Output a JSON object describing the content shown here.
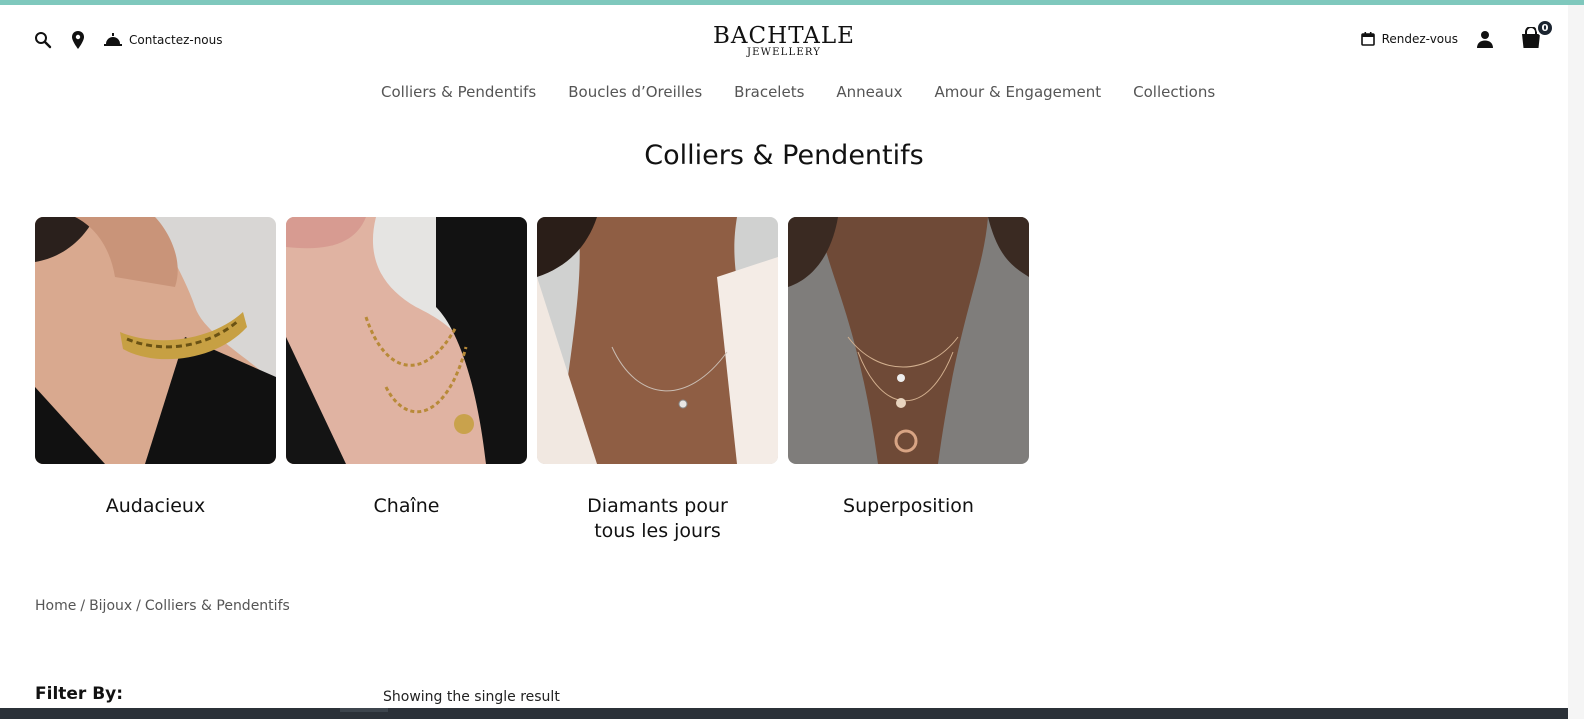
{
  "colors": {
    "accent": "#7fc8bd",
    "text": "#111111",
    "muted": "#555555",
    "badge": "#1b2430"
  },
  "header": {
    "icons": [
      "search-icon",
      "location-pin-icon",
      "service-bell-icon"
    ],
    "contact_label": "Contactez-nous",
    "logo_main": "BACHTALE",
    "logo_sub": "JEWELLERY",
    "appointment_label": "Rendez-vous",
    "cart_count": "0"
  },
  "nav": {
    "items": [
      {
        "label": "Colliers & Pendentifs"
      },
      {
        "label": "Boucles d’Oreilles"
      },
      {
        "label": "Bracelets"
      },
      {
        "label": "Anneaux"
      },
      {
        "label": "Amour & Engagement"
      },
      {
        "label": "Collections"
      }
    ]
  },
  "page": {
    "title": "Colliers & Pendentifs"
  },
  "categories": [
    {
      "label": "Audacieux"
    },
    {
      "label": "Chaîne"
    },
    {
      "label": "Diamants pour tous les jours"
    },
    {
      "label": "Superposition"
    }
  ],
  "breadcrumb": {
    "items": [
      {
        "label": "Home"
      },
      {
        "label": "Bijoux"
      },
      {
        "label": "Colliers & Pendentifs"
      }
    ],
    "separator": "/"
  },
  "shop": {
    "filter_label": "Filter By:",
    "result_text": "Showing the single result"
  }
}
